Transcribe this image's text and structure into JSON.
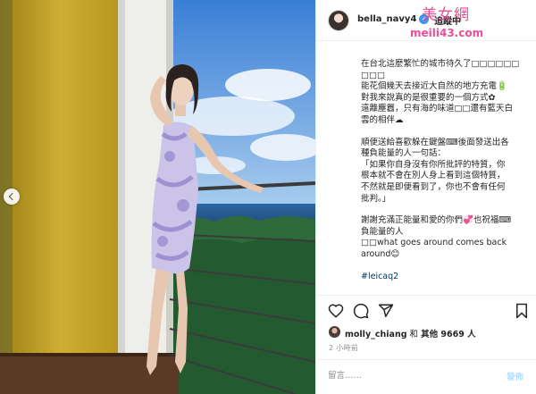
{
  "post": {
    "username": "bella_navy4",
    "verified_glyph": "✓",
    "follow_label": "追蹤中",
    "caption_lines": [
      "在台北這麼繁忙的城市待久了□□□□□□",
      "□□□",
      "能花個幾天去接近大自然的地方充電🔋",
      "對我來說真的是很重要的一個方式✿",
      "遠離塵囂，只有海的味道□□還有藍天白",
      "雲的相伴☁",
      "",
      "順便送給喜歡躲在鍵盤⌨後面發送出各",
      "種負能量的人一句話：",
      "「如果你自身沒有你所批評的特質，你",
      "根本就不會在別人身上看到這個特質，",
      "不然就是即便看到了，你也不會有任何",
      "批判。」",
      "",
      "謝謝充滿正能量和愛的你們💞也祝福⌨",
      "負能量的人",
      "□□what goes around comes back",
      "around😊"
    ],
    "hashtag": "#leicaq2",
    "likes_user": "molly_chiang",
    "likes_mid": " 和 ",
    "likes_others": "其他 9669 人",
    "time": "2 小時前",
    "comment_placeholder": "留言……",
    "post_label": "發佈"
  },
  "watermark": {
    "line1": "美女網",
    "line2": "meili43.com"
  },
  "icons": [
    "heart-icon",
    "comment-icon",
    "share-icon",
    "bookmark-icon",
    "chevron-left-icon"
  ],
  "colors": {
    "wall": "#c9a62d",
    "sky": "#3f86d8",
    "sea": "#2a5f92",
    "accent": "#3897f0",
    "hashtag": "#00376b",
    "watermark": "#e8418f"
  }
}
